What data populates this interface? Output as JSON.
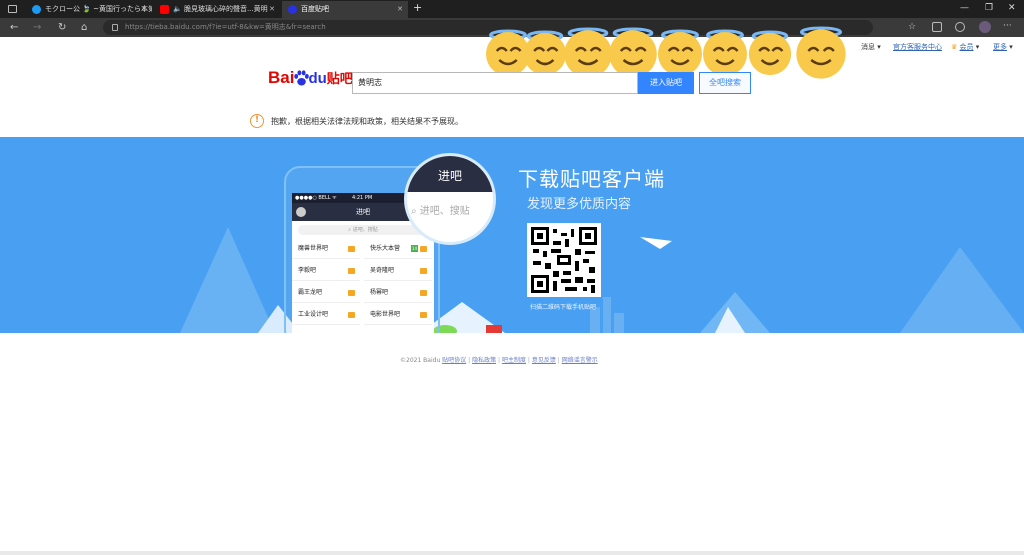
{
  "browser": {
    "tabs": [
      {
        "title": "モクロー公 🍃 ~黄国行ったら本気に",
        "icon_color": "#1d9bf0"
      },
      {
        "title": "脆見玻璃心碎的聲音...黄明",
        "icon_color": "#ff0000"
      },
      {
        "title": "百度贴吧",
        "icon_color": "#2932e1"
      }
    ],
    "url": "https://tieba.baidu.com/f?ie=utf-8&kw=黄明志&fr=search"
  },
  "topnav": {
    "messages": "消息",
    "service_center": "官方客服务中心",
    "vip": "会员",
    "more": "更多"
  },
  "logo": {
    "bai": "Bai",
    "du": "du",
    "tieba": "贴吧"
  },
  "search": {
    "value": "黄明志",
    "enter_button": "进入贴吧",
    "all_button": "全吧搜索"
  },
  "notice": {
    "icon_symbol": "!",
    "text": "抱歉，根据相关法律法规和政策，相关结果不予展现。"
  },
  "banner": {
    "headline": "下载贴吧客户端",
    "subline": "发现更多优质内容",
    "qr_caption": "扫描二维码下载手机贴吧",
    "phone": {
      "status_carrier": "●●●●○ BELL ᯤ",
      "status_time": "4:21 PM",
      "header": "进吧",
      "search_placeholder": "进吧、搜贴",
      "forums": [
        {
          "name": "魔兽世界吧",
          "extra": ""
        },
        {
          "name": "快乐大本营",
          "extra": "14"
        },
        {
          "name": "李毅吧",
          "extra": ""
        },
        {
          "name": "吴奇隆吧",
          "extra": ""
        },
        {
          "name": "霸王龙吧",
          "extra": ""
        },
        {
          "name": "杨幂吧",
          "extra": ""
        },
        {
          "name": "工业设计吧",
          "extra": ""
        },
        {
          "name": "电影世界吧",
          "extra": ""
        }
      ]
    },
    "magnifier": {
      "header": "进吧",
      "search": "进吧、搜贴"
    }
  },
  "footer": {
    "copyright": "©2021 Baidu",
    "links": [
      "贴吧协议",
      "隐私政策",
      "吧主制度",
      "意见反馈",
      "网络谣言警示"
    ]
  },
  "colors": {
    "brand_red": "#e10602",
    "brand_blue": "#2932e1",
    "button_blue": "#3385ff",
    "banner": "#49a0f2"
  }
}
